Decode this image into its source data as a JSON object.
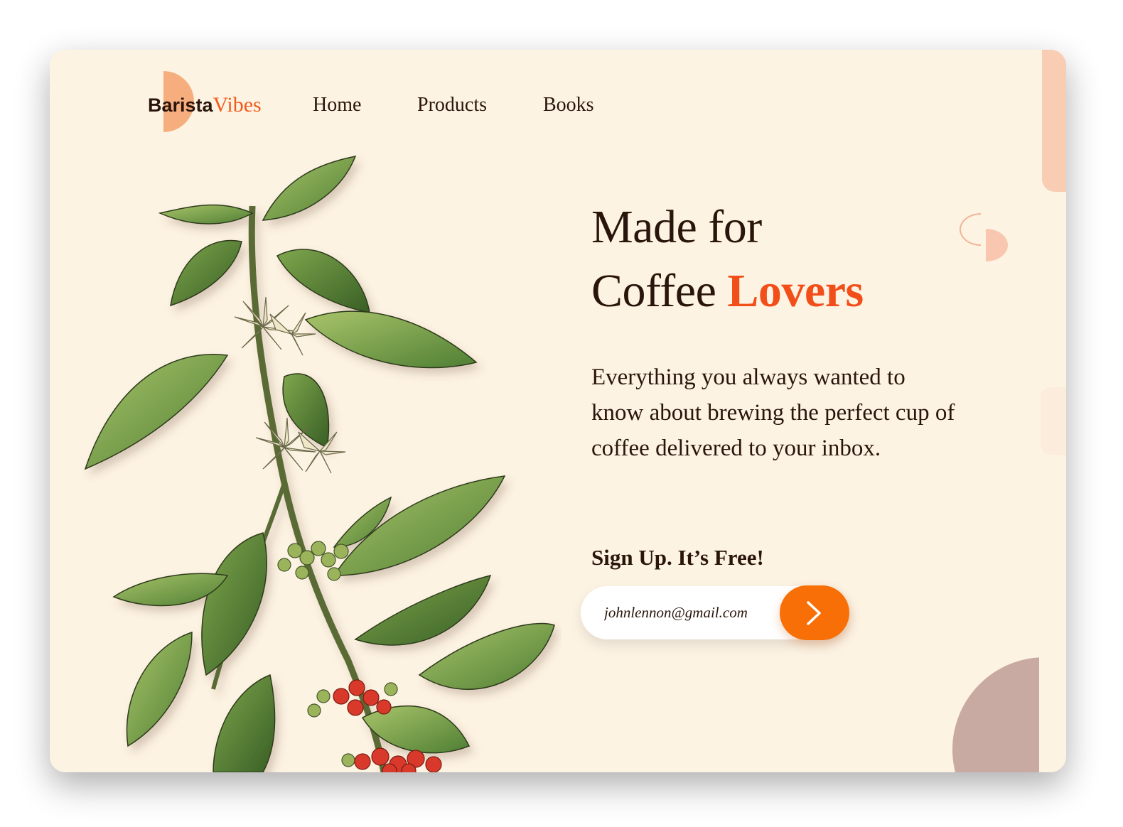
{
  "brand": {
    "part1": "Barista",
    "part2": "Vibes"
  },
  "nav": {
    "items": [
      {
        "label": "Home"
      },
      {
        "label": "Products"
      },
      {
        "label": "Books"
      }
    ]
  },
  "hero": {
    "line1": "Made for",
    "line2_plain": "Coffee",
    "line2_accent": "Lovers",
    "description": "Everything you always wanted to know about brewing the perfect cup of coffee delivered to your inbox.",
    "signup_label": "Sign Up. It’s Free!"
  },
  "signup": {
    "email_value": "johnlennon@gmail.com",
    "submit_icon": "chevron-right-icon"
  },
  "colors": {
    "background": "#fdf3e3",
    "accent": "#f24e1a",
    "button": "#f86f08",
    "text": "#2a150c",
    "peach": "#f6ae7e",
    "mauve": "#c9aaa2"
  },
  "illustration": {
    "name": "coffee-plant-illustration"
  }
}
